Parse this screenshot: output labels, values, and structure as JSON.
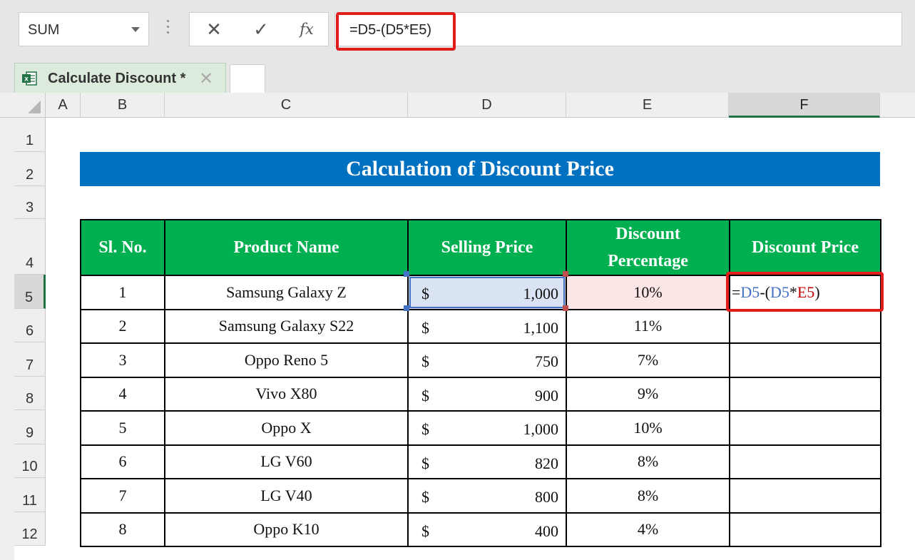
{
  "formula_bar": {
    "name_box": "SUM",
    "cancel_icon": "✕",
    "enter_icon": "✓",
    "fx_label": "fx",
    "formula": "=D5-(D5*E5)"
  },
  "tabs": [
    {
      "label": "Calculate Discount *",
      "close": "✕"
    }
  ],
  "columns": [
    "A",
    "B",
    "C",
    "D",
    "E",
    "F"
  ],
  "rows": [
    "1",
    "2",
    "3",
    "4",
    "5",
    "6",
    "7",
    "8",
    "9",
    "10",
    "11",
    "12"
  ],
  "title": "Calculation of Discount Price",
  "table": {
    "headers": [
      "Sl. No.",
      "Product Name",
      "Selling Price",
      "Discount Percentage",
      "Discount Price"
    ],
    "currency": "$",
    "rows": [
      {
        "sl": "1",
        "name": "Samsung Galaxy Z",
        "price": "1,000",
        "pct": "10%"
      },
      {
        "sl": "2",
        "name": "Samsung Galaxy S22",
        "price": "1,100",
        "pct": "11%"
      },
      {
        "sl": "3",
        "name": "Oppo Reno 5",
        "price": "750",
        "pct": "7%"
      },
      {
        "sl": "4",
        "name": "Vivo X80",
        "price": "900",
        "pct": "9%"
      },
      {
        "sl": "5",
        "name": "Oppo X",
        "price": "1,000",
        "pct": "10%"
      },
      {
        "sl": "6",
        "name": "LG V60",
        "price": "820",
        "pct": "8%"
      },
      {
        "sl": "7",
        "name": "LG V40",
        "price": "800",
        "pct": "8%"
      },
      {
        "sl": "8",
        "name": "Oppo K10",
        "price": "400",
        "pct": "4%"
      }
    ],
    "editing_formula": {
      "eq": "=",
      "ref1": "D5",
      "minus": "-(",
      "ref2": "D5",
      "times": "*",
      "ref3": "E5",
      "close": ")"
    }
  },
  "colors": {
    "accent_green": "#217346",
    "header_green": "#00b050",
    "banner_blue": "#0070c0",
    "highlight_red": "#e21b1b"
  }
}
